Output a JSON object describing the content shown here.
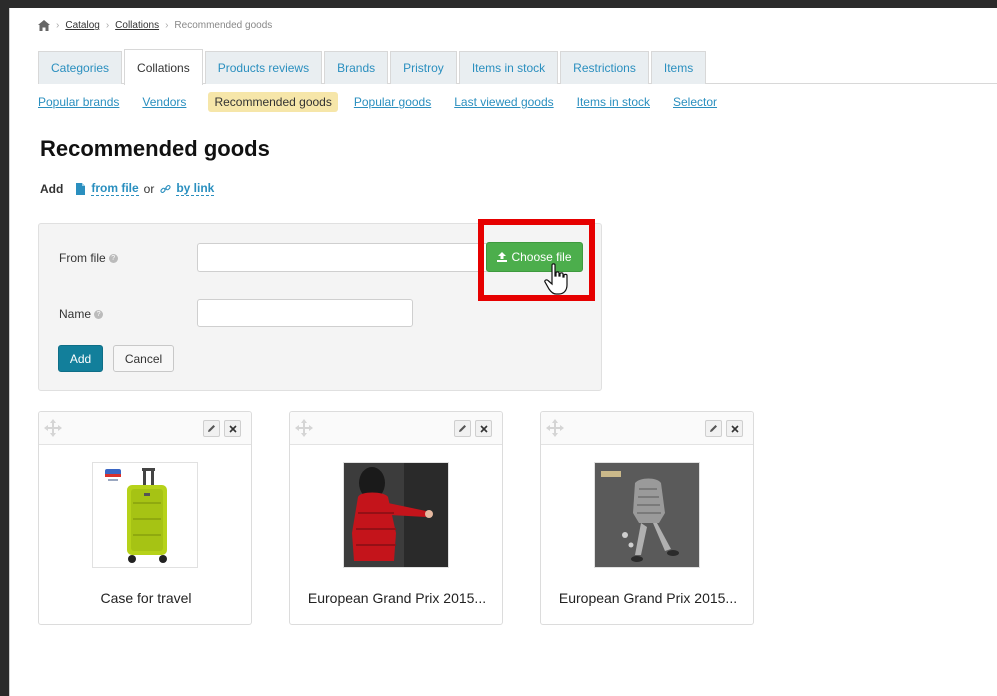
{
  "breadcrumb": {
    "catalog": "Catalog",
    "collations": "Collations",
    "current": "Recommended goods",
    "sep": "›"
  },
  "tabs": [
    {
      "label": "Categories"
    },
    {
      "label": "Collations"
    },
    {
      "label": "Products reviews"
    },
    {
      "label": "Brands"
    },
    {
      "label": "Pristroy"
    },
    {
      "label": "Items in stock"
    },
    {
      "label": "Restrictions"
    },
    {
      "label": "Items"
    }
  ],
  "subnav": [
    {
      "label": "Popular brands"
    },
    {
      "label": "Vendors"
    },
    {
      "label": "Recommended goods"
    },
    {
      "label": "Popular goods"
    },
    {
      "label": "Last viewed goods"
    },
    {
      "label": "Items in stock"
    },
    {
      "label": "Selector"
    }
  ],
  "page": {
    "title": "Recommended goods",
    "add_label": "Add",
    "from_file_link": "from file",
    "or_text": "or",
    "by_link_link": "by link"
  },
  "form": {
    "from_file_label": "From file",
    "name_label": "Name",
    "choose_file_button": "Choose file",
    "add_button": "Add",
    "cancel_button": "Cancel",
    "help_glyph": "?"
  },
  "cards": [
    {
      "title": "Case for travel"
    },
    {
      "title": "European Grand Prix 2015..."
    },
    {
      "title": "European Grand Prix 2015..."
    }
  ],
  "colors": {
    "tab_link": "#2a8fbf",
    "active_subnav_bg": "#f6e6a9",
    "primary_button": "#127f9b",
    "success_button": "#4cae4c",
    "highlight": "#e60000"
  }
}
